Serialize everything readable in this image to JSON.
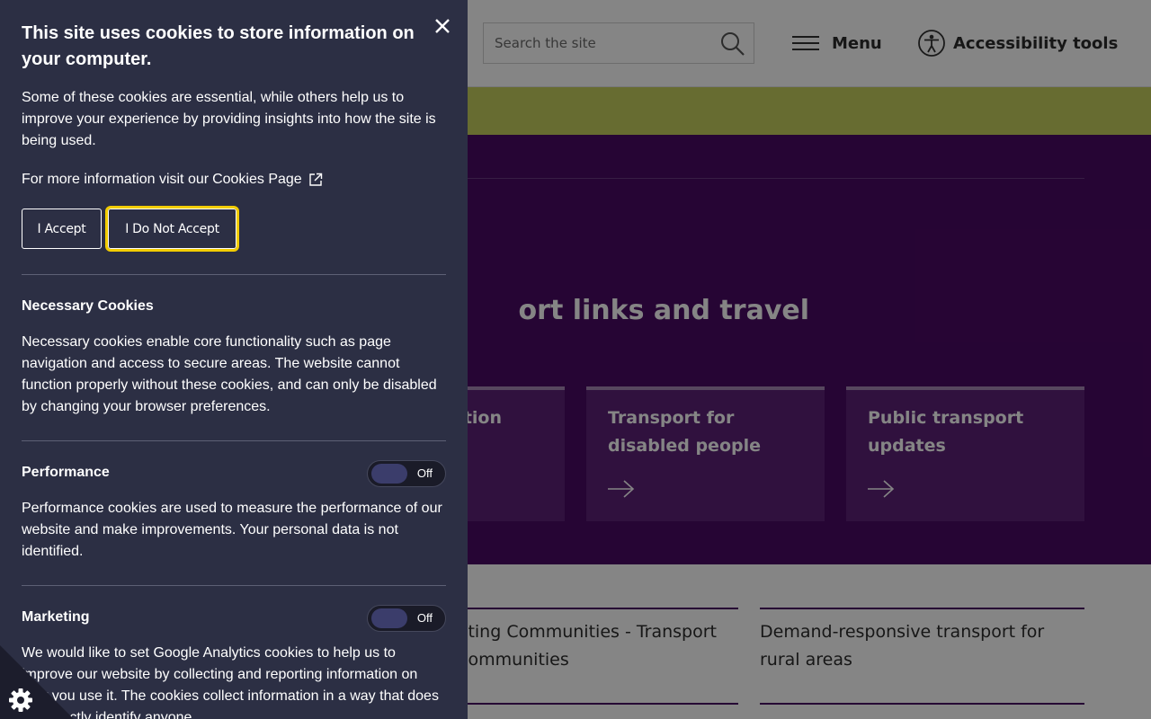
{
  "header": {
    "search_placeholder": "Search the site",
    "menu_label": "Menu",
    "accessibility_label": "Accessibility tools"
  },
  "hero": {
    "title_fragment": "ort links and travel",
    "cards": [
      {
        "title": "tion"
      },
      {
        "title": "Transport for disabled people"
      },
      {
        "title": "Public transport updates"
      }
    ]
  },
  "related": {
    "links": [
      {
        "text": "cting Communities - Transport communities"
      },
      {
        "text": "Demand-responsive transport for rural areas"
      }
    ]
  },
  "cookie_panel": {
    "heading": "This site uses cookies to store information on your computer.",
    "intro": "Some of these cookies are essential, while others help us to improve your experience by providing insights into how the site is being used.",
    "more_info_prefix": "For more information visit our",
    "more_info_link": "Cookies Page",
    "accept_label": "I Accept",
    "decline_label": "I Do Not Accept",
    "sections": [
      {
        "title": "Necessary Cookies",
        "text": "Necessary cookies enable core functionality such as page navigation and access to secure areas. The website cannot function properly without these cookies, and can only be disabled by changing your browser preferences."
      },
      {
        "title": "Performance",
        "toggle": "Off",
        "text": "Performance cookies are used to measure the performance of our website and make improvements. Your personal data is not identified."
      },
      {
        "title": "Marketing",
        "toggle": "Off",
        "text": "We would like to set Google Analytics cookies to help us to improve our website by collecting and reporting information on how you use it. The cookies collect information in a way that does not directly identify anyone."
      }
    ]
  },
  "colors": {
    "panel_bg": "#2c2f44",
    "hero_bg": "#4a0a64",
    "alert_band": "#c5d05f",
    "focus_outline": "#f2cc00"
  }
}
